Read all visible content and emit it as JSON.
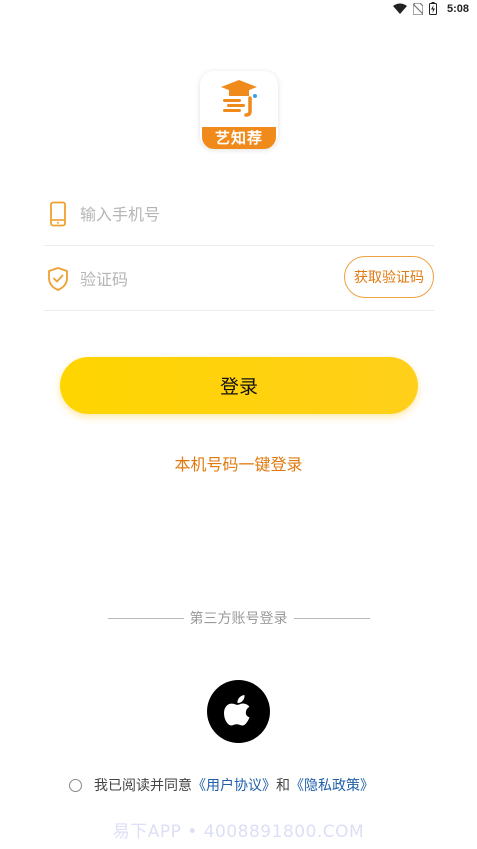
{
  "status_bar": {
    "time": "5:08",
    "icons": [
      "wifi-icon",
      "no-sim-icon",
      "battery-icon"
    ]
  },
  "logo": {
    "text": "艺知荐",
    "brand_color": "#f08a1a"
  },
  "form": {
    "phone": {
      "placeholder": "输入手机号",
      "value": "",
      "icon": "phone-icon"
    },
    "code": {
      "placeholder": "验证码",
      "value": "",
      "icon": "shield-check-icon"
    },
    "get_code_label": "获取验证码"
  },
  "login_label": "登录",
  "one_key_login_label": "本机号码一键登录",
  "third_party": {
    "label": "第三方账号登录",
    "providers": [
      "apple-icon"
    ]
  },
  "agreement": {
    "prefix": "我已阅读并同意",
    "user_agreement": "《用户协议》",
    "conjunction": "和",
    "privacy_policy": "《隐私政策》",
    "checked": false
  },
  "watermark": "易下APP • 4008891800.COM",
  "colors": {
    "accent": "#ffd500",
    "link_orange": "#e07a10",
    "link_blue": "#1f5fa8"
  }
}
